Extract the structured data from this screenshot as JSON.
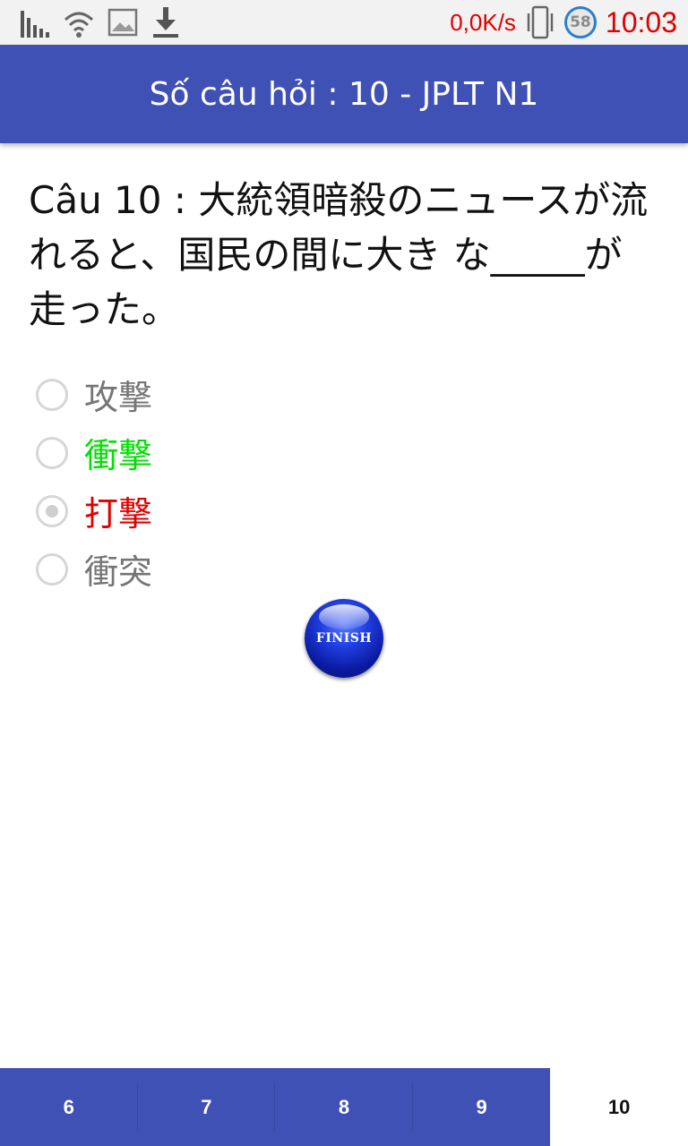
{
  "status_bar": {
    "icons": [
      "signal-bars-icon",
      "wifi-icon",
      "image-icon",
      "download-icon",
      "vibrate-icon",
      "timer-icon"
    ],
    "net_speed": "0,0K/s",
    "timer_value": "58",
    "time": "10:03",
    "accent_color": "#e00000"
  },
  "app_bar": {
    "title": "Số câu hỏi : 10 - JPLT N1",
    "color": "#3f51b5"
  },
  "question": {
    "text": "Câu 10 : 大統領暗殺のニュースが流れると、国民の間に大き な_____が走った。"
  },
  "options": [
    {
      "label": "攻撃",
      "state": "neutral",
      "color": "#757575",
      "checked": false
    },
    {
      "label": "衝撃",
      "state": "correct",
      "color": "#00e000",
      "checked": false
    },
    {
      "label": "打撃",
      "state": "wrong",
      "color": "#e00000",
      "checked": true
    },
    {
      "label": "衝突",
      "state": "neutral",
      "color": "#757575",
      "checked": false
    }
  ],
  "finish_button": {
    "label": "FINISH"
  },
  "bottom_nav": {
    "tabs": [
      {
        "label": "6",
        "active": false
      },
      {
        "label": "7",
        "active": false
      },
      {
        "label": "8",
        "active": false
      },
      {
        "label": "9",
        "active": false
      },
      {
        "label": "10",
        "active": true
      }
    ]
  }
}
